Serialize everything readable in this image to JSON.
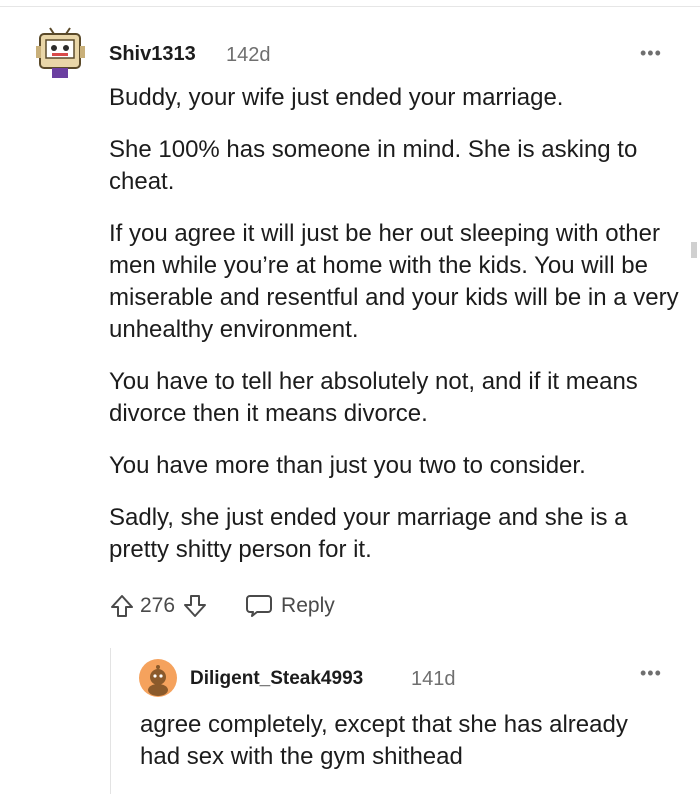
{
  "comment": {
    "username": "Shiv1313",
    "age": "142d",
    "more_icon": "ellipsis-icon",
    "paragraphs": [
      "Buddy, your wife just ended your marriage.",
      "She 100% has someone in mind. She is asking to cheat.",
      "If you agree it will just be her out sleeping with other men while you’re at home with the kids. You will be miserable and resentful and your kids will be in a very unhealthy environment.",
      "You have to tell her absolutely not, and if it means divorce then it means divorce.",
      "You have more than just you two to consider.",
      "Sadly, she just ended your marriage and she is a pretty shitty person for it."
    ],
    "score": "276",
    "reply_label": "Reply"
  },
  "reply": {
    "username": "Diligent_Steak4993",
    "age": "141d",
    "more_icon": "ellipsis-icon",
    "text": "agree completely, except that she has already had sex with the gym shithead"
  },
  "colors": {
    "text": "#1c1c1c",
    "meta": "#6f6f6f",
    "action": "#4a4a4a",
    "avatar_orange": "#f5a25d",
    "avatar_brown": "#8b5a2b"
  }
}
